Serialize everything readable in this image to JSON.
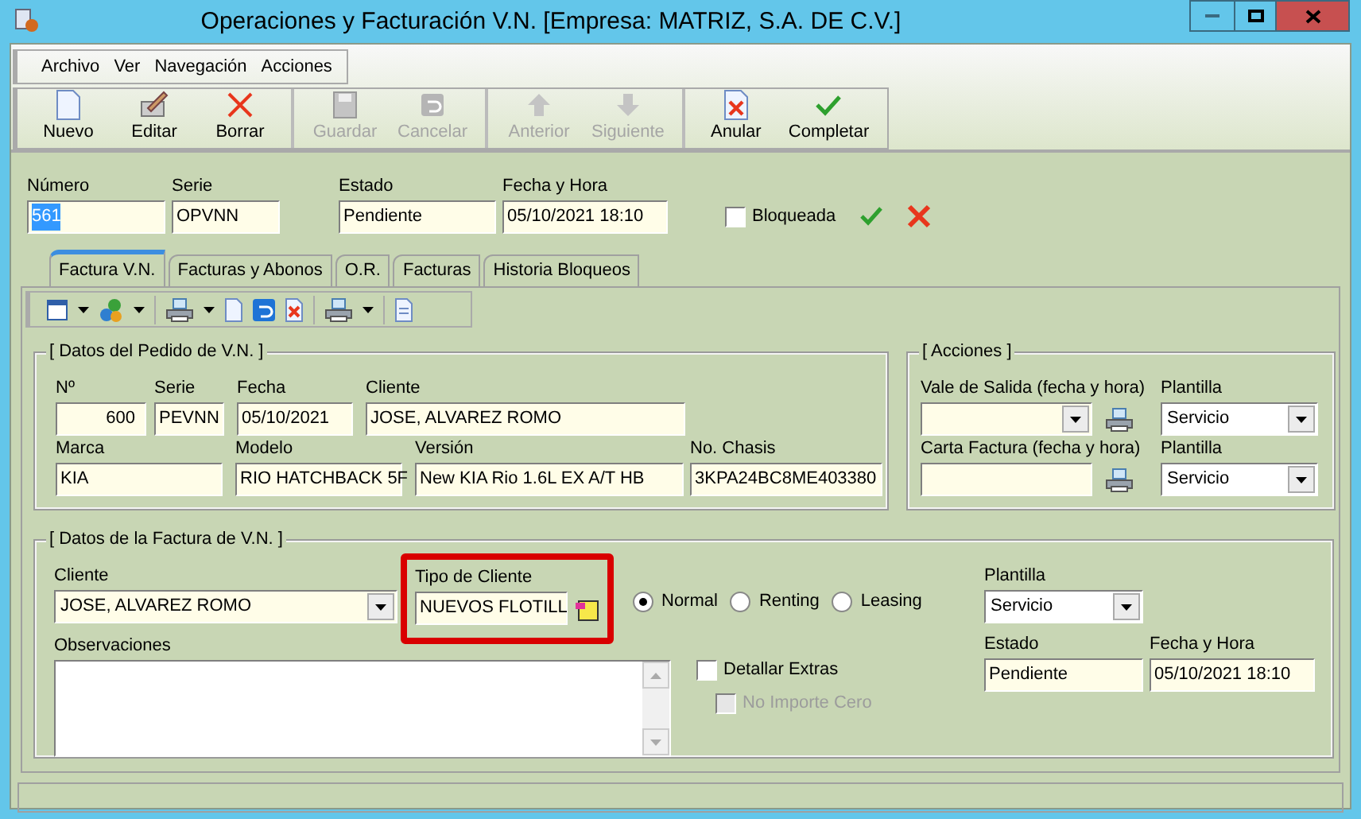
{
  "window": {
    "title": "Operaciones y Facturación V.N. [Empresa: MATRIZ, S.A. DE C.V.]"
  },
  "menu": [
    "Archivo",
    "Ver",
    "Navegación",
    "Acciones"
  ],
  "toolbar": [
    [
      {
        "label": "Nuevo",
        "disabled": false
      },
      {
        "label": "Editar",
        "disabled": false
      },
      {
        "label": "Borrar",
        "disabled": false
      }
    ],
    [
      {
        "label": "Guardar",
        "disabled": true
      },
      {
        "label": "Cancelar",
        "disabled": true
      }
    ],
    [
      {
        "label": "Anterior",
        "disabled": true
      },
      {
        "label": "Siguiente",
        "disabled": true
      }
    ],
    [
      {
        "label": "Anular",
        "disabled": false
      },
      {
        "label": "Completar",
        "disabled": false
      }
    ]
  ],
  "header": {
    "numero": {
      "label": "Número",
      "value": "561",
      "text_selected": true
    },
    "serie": {
      "label": "Serie",
      "value": "OPVNN"
    },
    "estado": {
      "label": "Estado",
      "value": "Pendiente"
    },
    "fecha": {
      "label": "Fecha y Hora",
      "value": "05/10/2021 18:10"
    },
    "bloqueada": {
      "label": "Bloqueada",
      "checked": false
    }
  },
  "tabs": [
    {
      "label": "Factura V.N.",
      "selected": true
    },
    {
      "label": "Facturas y Abonos",
      "selected": false
    },
    {
      "label": "O.R.",
      "selected": false
    },
    {
      "label": "Facturas",
      "selected": false
    },
    {
      "label": "Historia Bloqueos",
      "selected": false
    }
  ],
  "pedido": {
    "title": "[ Datos del Pedido de V.N. ]",
    "row_1": [
      {
        "label": "Nº",
        "value": "600"
      },
      {
        "label": "Serie",
        "value": "PEVNN"
      },
      {
        "label": "Fecha",
        "value": "05/10/2021"
      },
      {
        "label": "Cliente",
        "value": "JOSE, ALVAREZ ROMO"
      }
    ],
    "row_2": [
      {
        "label": "Marca",
        "value": "KIA"
      },
      {
        "label": "Modelo",
        "value": "RIO HATCHBACK 5F"
      },
      {
        "label": "Versión",
        "value": "New KIA Rio 1.6L EX A/T HB"
      },
      {
        "label": "No. Chasis",
        "value": "3KPA24BC8ME403380"
      }
    ]
  },
  "acciones": {
    "title": "[ Acciones ]",
    "rows": [
      {
        "label": "Vale de Salida (fecha y hora)",
        "plantilla_label": "Plantilla",
        "plantilla_value": "Servicio"
      },
      {
        "label": "Carta Factura (fecha y hora)",
        "plantilla_label": "Plantilla",
        "plantilla_value": "Servicio"
      }
    ]
  },
  "factura": {
    "title": "[ Datos de la Factura de V.N. ]",
    "cliente": {
      "label": "Cliente",
      "value": "JOSE, ALVAREZ ROMO"
    },
    "tipo_cliente": {
      "label": "Tipo de Cliente",
      "value": "NUEVOS FLOTILL",
      "highlighted": true
    },
    "radios": [
      {
        "label": "Normal",
        "selected": true
      },
      {
        "label": "Renting",
        "selected": false
      },
      {
        "label": "Leasing",
        "selected": false
      }
    ],
    "plantilla": {
      "label": "Plantilla",
      "value": "Servicio"
    },
    "observaciones": {
      "label": "Observaciones"
    },
    "checkboxes": [
      {
        "label": "Detallar Extras",
        "checked": false,
        "disabled": false
      },
      {
        "label": "No Importe Cero",
        "checked": false,
        "disabled": true
      }
    ],
    "estado": {
      "label": "Estado",
      "value": "Pendiente"
    },
    "fecha": {
      "label": "Fecha y Hora",
      "value": "05/10/2021 18:10"
    }
  }
}
